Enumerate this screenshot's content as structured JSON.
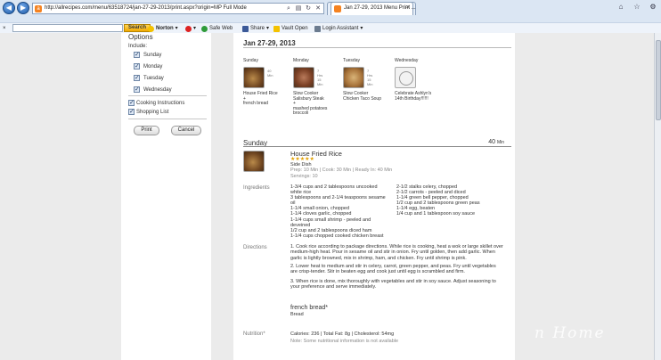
{
  "browser": {
    "url": "http://allrecipes.com/menu/63518724/jan-27-29-2013/print.aspx?origin=MP Full Mode",
    "tabs": [
      {
        "title": "Jan 27-29, 2013 Menu Print ..."
      }
    ],
    "toolbar": {
      "search_button": "Search",
      "norton": "Norton",
      "safe_web": "Safe Web",
      "share": "Share",
      "vault": "Vault Open",
      "login": "Login Assistant"
    }
  },
  "sidebar": {
    "title": "Options",
    "include_label": "Include:",
    "days": [
      "Sunday",
      "Monday",
      "Tuesday",
      "Wednesday"
    ],
    "extras": [
      "Cooking Instructions",
      "Shopping List"
    ],
    "print_label": "Print",
    "cancel_label": "Cancel"
  },
  "menu": {
    "date_range": "Jan 27-29, 2013",
    "days": [
      {
        "name": "Sunday",
        "info": [
          "40",
          "Min"
        ],
        "lines": [
          "House Fried Rice",
          "+",
          "french bread"
        ]
      },
      {
        "name": "Monday",
        "info": [
          "7",
          "Hrs",
          "15",
          "Min"
        ],
        "lines": [
          "Slow Cooker",
          "Salisbury Steak",
          "+",
          "mashed potatoes",
          "broccoli"
        ]
      },
      {
        "name": "Tuesday",
        "info": [
          "7",
          "Hrs",
          "15",
          "Min"
        ],
        "lines": [
          "Slow Cooker",
          "Chicken Taco Soup"
        ]
      },
      {
        "name": "Wednesday",
        "info": [],
        "lines": [
          "Celebrate Ashlyn's",
          "14th Birthday!!!!!!"
        ]
      }
    ]
  },
  "section": {
    "day": "Sunday",
    "minutes": "40",
    "minutes_unit": "Min"
  },
  "recipe": {
    "title": "House Fried Rice",
    "stars": "★★★★★",
    "category": "Side Dish",
    "times": "Prep: 10 Min | Cook: 30 Min | Ready In: 40 Min",
    "servings": "Servings: 10",
    "ingredients_label": "Ingredients",
    "ingredients_left": [
      "1-3/4 cups and 2 tablespoons uncooked",
      "white rice",
      "3 tablespoons and 2-1/4 teaspoons sesame",
      "oil",
      "1-1/4 small onion, chopped",
      "1-1/4 cloves garlic, chopped",
      "1-1/4 cups small shrimp - peeled and",
      "deveined",
      "1/2 cup and 2 tablespoons diced ham",
      "1-1/4 cups chopped cooked chicken breast"
    ],
    "ingredients_right": [
      "2-1/2 stalks celery, chopped",
      "2-1/2 carrots - peeled and diced",
      "1-1/4 green bell pepper, chopped",
      "1/2 cup and 2 tablespoons green peas",
      "1-1/4 egg, beaten",
      "1/4 cup and 1 tablespoon soy sauce"
    ],
    "directions_label": "Directions",
    "directions": [
      "1.    Cook rice according to package directions. While rice is cooking, heat a wok or large skillet over medium-high heat. Pour in sesame oil and stir in onion. Fry until golden, then add garlic. When garlic is lightly browned, mix in shrimp, ham, and chicken. Fry until shrimp is pink.",
      "2.    Lower heat to medium and stir in celery, carrot, green pepper, and peas. Fry until vegetables are crisp-tender. Stir in beaten egg and cook just until egg is scrambled and firm.",
      "3.    When rice is done, mix thoroughly with vegetables and stir in soy sauce. Adjust seasoning to your preference and serve immediately."
    ],
    "side_title": "french bread*",
    "side_sub": "Bread",
    "nutrition_label": "Nutrition*",
    "nutrition": "Calories: 236 | Total Fat: 8g | Cholesterol: 54mg",
    "nutrition_note": "Note: Some nutritional information is not available"
  },
  "watermark": "n Home"
}
